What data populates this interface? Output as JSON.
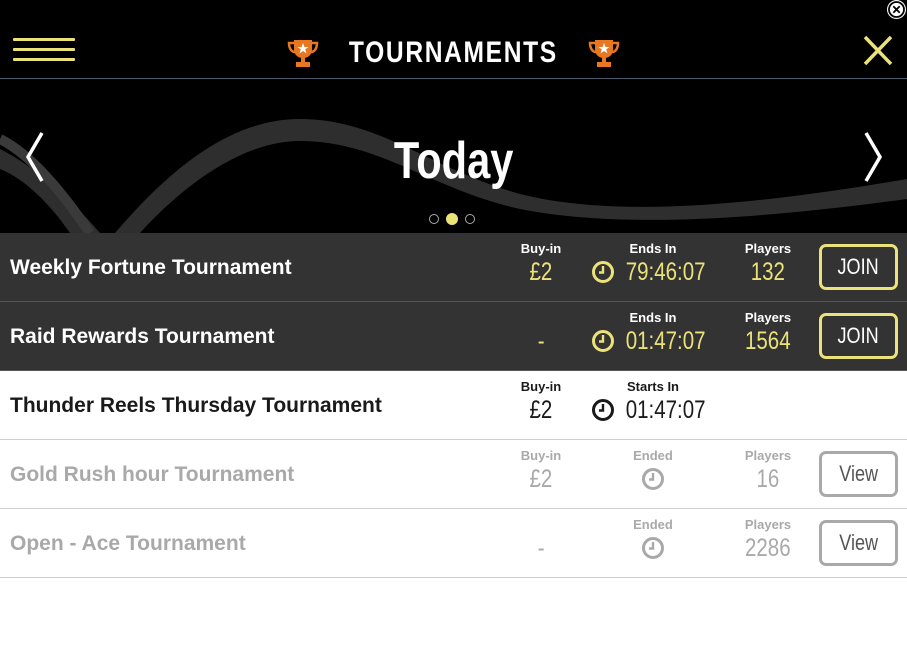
{
  "header": {
    "title": "TOURNAMENTS",
    "menu_icon": "hamburger-menu-icon",
    "close_icon": "close-x-icon",
    "accent_color": "#ece27a",
    "trophy_color": "#e87722"
  },
  "hero": {
    "title": "Today",
    "prev_icon": "chevron-left-icon",
    "next_icon": "chevron-right-icon",
    "dots_count": 3,
    "active_dot": 2
  },
  "tournaments": [
    {
      "name": "Weekly Fortune Tournament",
      "buyin_label": "Buy-in",
      "buyin": "£2",
      "time_label": "Ends In",
      "time": "79:46:07",
      "players_label": "Players",
      "players": "132",
      "button": "JOIN",
      "style": "active"
    },
    {
      "name": "Raid Rewards Tournament",
      "buyin_label": "",
      "buyin": "-",
      "time_label": "Ends In",
      "time": "01:47:07",
      "players_label": "Players",
      "players": "1564",
      "button": "JOIN",
      "style": "active"
    },
    {
      "name": "Thunder Reels Thursday Tournament",
      "buyin_label": "Buy-in",
      "buyin": "£2",
      "time_label": "Starts In",
      "time": "01:47:07",
      "players_label": "",
      "players": "",
      "button": "",
      "style": "upcoming"
    },
    {
      "name": "Gold Rush hour Tournament",
      "buyin_label": "Buy-in",
      "buyin": "£2",
      "time_label": "Ended",
      "time": "",
      "players_label": "Players",
      "players": "16",
      "button": "View",
      "style": "ended"
    },
    {
      "name": "Open - Ace Tournament",
      "buyin_label": "",
      "buyin": "-",
      "time_label": "Ended",
      "time": "",
      "players_label": "Players",
      "players": "2286",
      "button": "View",
      "style": "ended"
    }
  ]
}
